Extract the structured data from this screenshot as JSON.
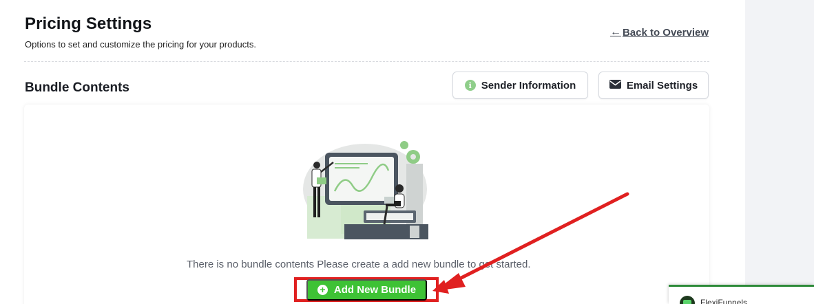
{
  "header": {
    "title": "Pricing Settings",
    "subtitle": "Options to set and customize the pricing for your products.",
    "back_arrow": "←",
    "back_label": "Back to Overview"
  },
  "section": {
    "title": "Bundle Contents",
    "sender_button": "Sender Information",
    "sender_icon": "info-icon",
    "email_button": "Email Settings",
    "email_icon": "envelope-icon"
  },
  "empty_state": {
    "message": "There is no bundle contents Please create a add new bundle to get started.",
    "add_button": "Add New Bundle",
    "add_icon": "plus-circle-icon"
  },
  "widget": {
    "name": "FlexiFunnels"
  },
  "colors": {
    "accent_green": "#3ec235",
    "annotation_red": "#e02020",
    "info_green": "#8fce8a"
  }
}
